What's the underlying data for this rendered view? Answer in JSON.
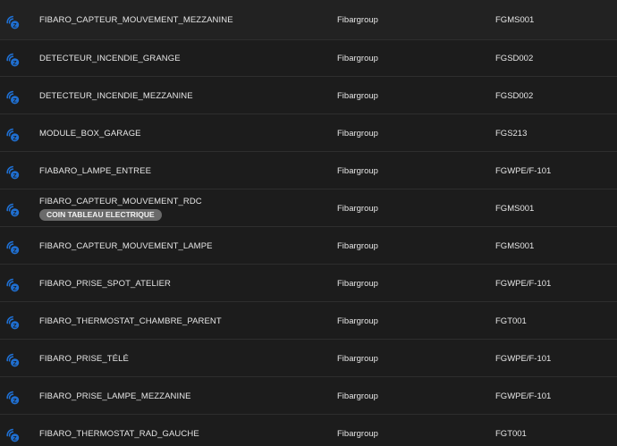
{
  "colors": {
    "background": "#1c1c1c",
    "row_divider": "#2e2e2e",
    "icon_blue": "#1f6fd1",
    "badge_bg": "#6a6a6a",
    "text": "#e6e6e6"
  },
  "rows": [
    {
      "icon": "zwave-icon",
      "name": "FIBARO_CAPTEUR_MOUVEMENT_MEZZANINE",
      "badge": "",
      "manufacturer": "Fibargroup",
      "model": "FGMS001"
    },
    {
      "icon": "zwave-icon",
      "name": "DETECTEUR_INCENDIE_GRANGE",
      "badge": "",
      "manufacturer": "Fibargroup",
      "model": "FGSD002"
    },
    {
      "icon": "zwave-icon",
      "name": "DETECTEUR_INCENDIE_MEZZANINE",
      "badge": "",
      "manufacturer": "Fibargroup",
      "model": "FGSD002"
    },
    {
      "icon": "zwave-icon",
      "name": "MODULE_BOX_GARAGE",
      "badge": "",
      "manufacturer": "Fibargroup",
      "model": "FGS213"
    },
    {
      "icon": "zwave-icon",
      "name": "FIABARO_LAMPE_ENTREE",
      "badge": "",
      "manufacturer": "Fibargroup",
      "model": "FGWPE/F-101"
    },
    {
      "icon": "zwave-icon",
      "name": "FIBARO_CAPTEUR_MOUVEMENT_RDC",
      "badge": "COIN TABLEAU ELECTRIQUE",
      "manufacturer": "Fibargroup",
      "model": "FGMS001"
    },
    {
      "icon": "zwave-icon",
      "name": "FIBARO_CAPTEUR_MOUVEMENT_LAMPE",
      "badge": "",
      "manufacturer": "Fibargroup",
      "model": "FGMS001"
    },
    {
      "icon": "zwave-icon",
      "name": "FIBARO_PRISE_SPOT_ATELIER",
      "badge": "",
      "manufacturer": "Fibargroup",
      "model": "FGWPE/F-101"
    },
    {
      "icon": "zwave-icon",
      "name": "FIBARO_THERMOSTAT_CHAMBRE_PARENT",
      "badge": "",
      "manufacturer": "Fibargroup",
      "model": "FGT001"
    },
    {
      "icon": "zwave-icon",
      "name": "FIBARO_PRISE_TÉLÉ",
      "badge": "",
      "manufacturer": "Fibargroup",
      "model": "FGWPE/F-101"
    },
    {
      "icon": "zwave-icon",
      "name": "FIBARO_PRISE_LAMPE_MEZZANINE",
      "badge": "",
      "manufacturer": "Fibargroup",
      "model": "FGWPE/F-101"
    },
    {
      "icon": "zwave-icon",
      "name": "FIBARO_THERMOSTAT_RAD_GAUCHE",
      "badge": "",
      "manufacturer": "Fibargroup",
      "model": "FGT001"
    }
  ]
}
